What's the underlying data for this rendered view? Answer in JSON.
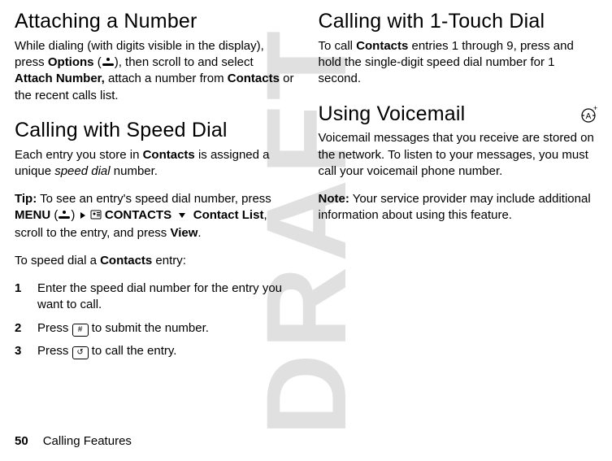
{
  "watermark": "DRAFT",
  "left": {
    "attach": {
      "heading": "Attaching a Number",
      "p1a": "While dialing (with digits visible in the display), press ",
      "options": "Options",
      "p1b": " (",
      "p1c": "), then scroll to and select ",
      "attachNumber": "Attach Number,",
      "p1d": " attach a number from ",
      "contacts": "Contacts",
      "p1e": " or the recent calls list."
    },
    "speed": {
      "heading": "Calling with Speed Dial",
      "p1a": "Each entry you store in ",
      "contacts": "Contacts",
      "p1b": " is assigned a unique ",
      "speedDial": "speed dial",
      "p1c": " number.",
      "tipLabel": "Tip:",
      "tip_a": " To see an entry's speed dial number, press ",
      "menu": "MENU",
      "tip_b": " (",
      "tip_c": ")  ",
      "contactsMenu": "CONTACTS",
      "contactList": "Contact List",
      "tip_d": ", scroll to the entry, and press ",
      "view": "View",
      "tip_e": ".",
      "p2a": "To speed dial a ",
      "p2b": " entry:",
      "step1": "Enter the speed dial number for the entry you want to call.",
      "step2a": "Press ",
      "hashKey": "#",
      "step2b": " to submit the number.",
      "step3a": "Press ",
      "callKey": "↺",
      "step3b": " to call the entry.",
      "n1": "1",
      "n2": "2",
      "n3": "3"
    }
  },
  "right": {
    "onetouch": {
      "heading": "Calling with 1-Touch Dial",
      "p1a": "To call ",
      "contacts": "Contacts",
      "p1b": " entries 1 through 9, press and hold the single-digit speed dial number for 1 second."
    },
    "voicemail": {
      "heading": "Using Voicemail",
      "p1": "Voicemail messages that you receive are stored on the network. To listen to your messages, you must call your voicemail phone number.",
      "noteLabel": "Note:",
      "note": " Your service provider may include additional information about using this feature."
    }
  },
  "footer": {
    "page": "50",
    "title": "Calling Features"
  }
}
